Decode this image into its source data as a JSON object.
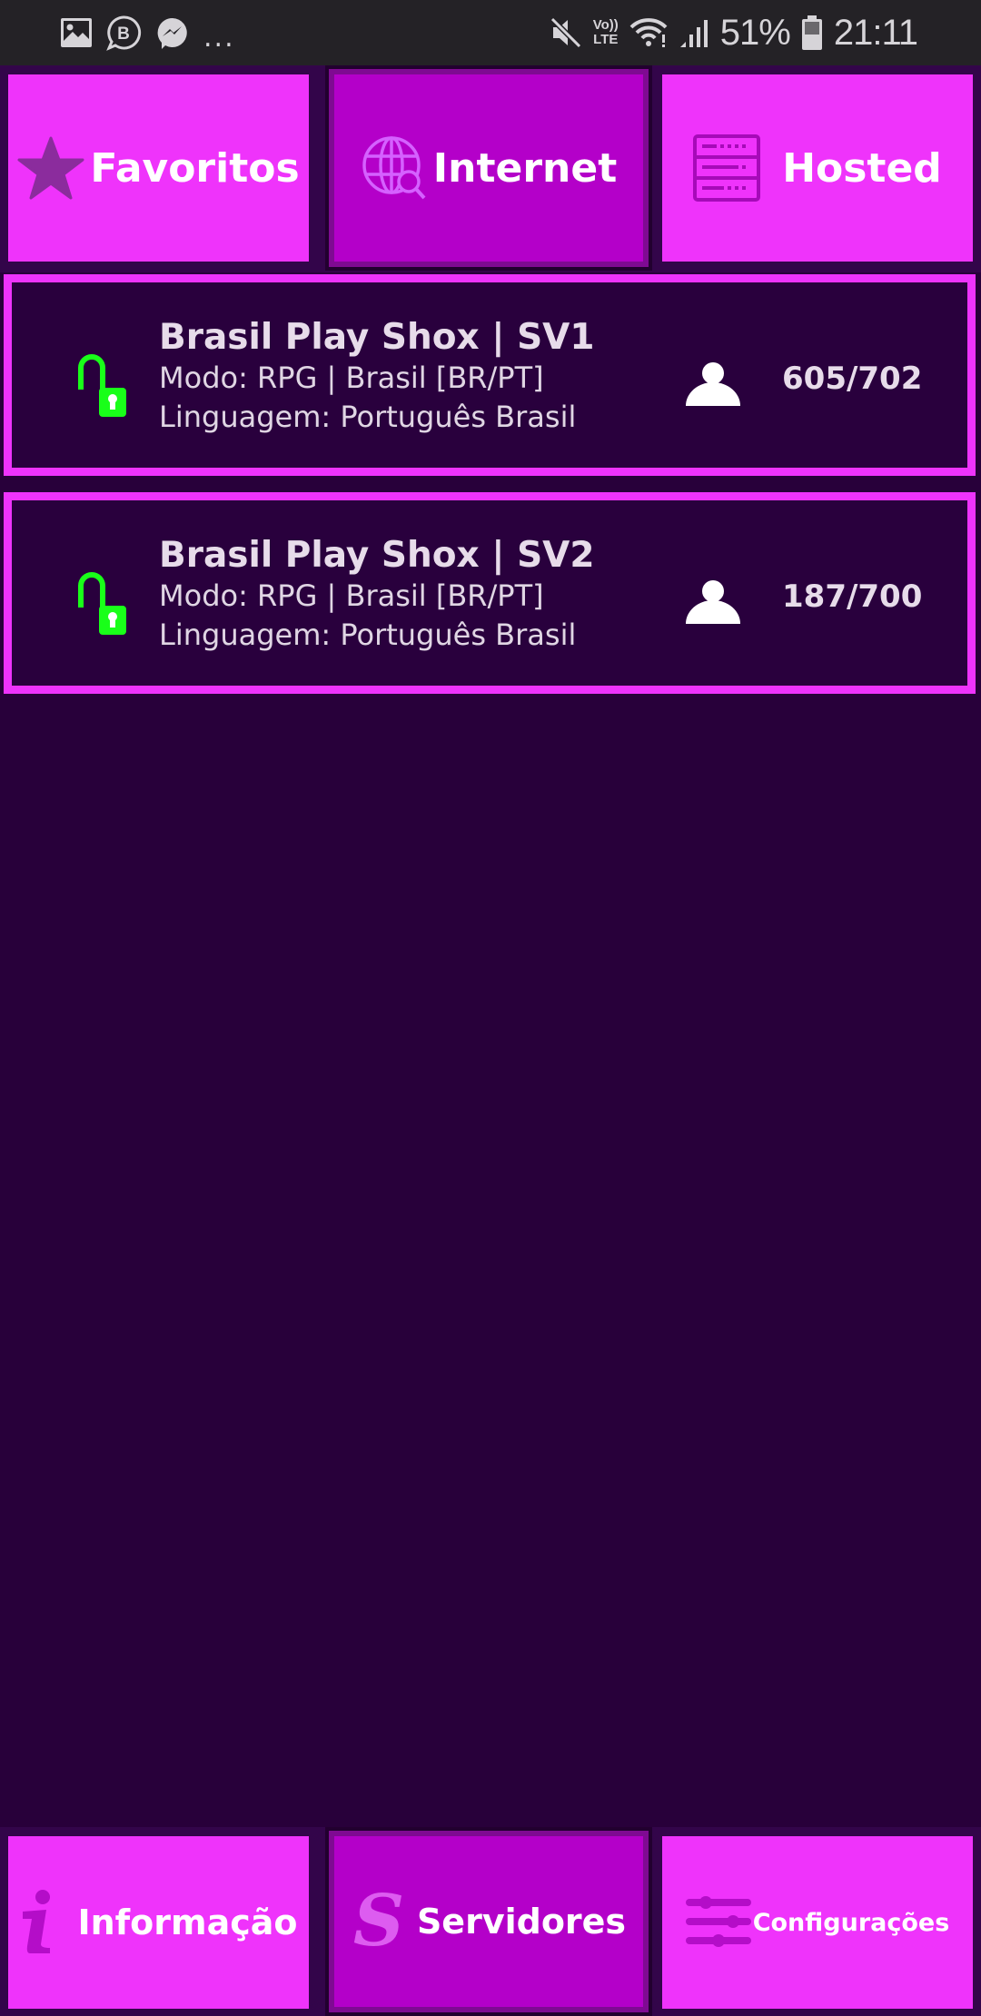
{
  "status_bar": {
    "notification_icons": [
      "gallery-icon",
      "business-chat-icon",
      "messenger-icon"
    ],
    "overflow": "...",
    "system_icons": [
      "mute-icon",
      "volte-icon",
      "wifi-icon",
      "signal-icon"
    ],
    "volte_top": "Vo))",
    "volte_bottom": "LTE",
    "battery_percent": "51%",
    "time": "21:11"
  },
  "top_tabs": [
    {
      "label": "Favoritos",
      "icon": "star-icon",
      "active": false
    },
    {
      "label": "Internet",
      "icon": "globe-search-icon",
      "active": true
    },
    {
      "label": "Hosted",
      "icon": "server-icon",
      "active": false
    }
  ],
  "servers": [
    {
      "name": "Brasil Play Shox | SV1",
      "mode": "Modo: RPG | Brasil [BR/PT]",
      "language": "Linguagem: Português Brasil",
      "players": "605/702",
      "locked": false
    },
    {
      "name": "Brasil Play Shox | SV2",
      "mode": "Modo: RPG | Brasil [BR/PT]",
      "language": "Linguagem: Português Brasil",
      "players": "187/700",
      "locked": false
    }
  ],
  "bottom_tabs": [
    {
      "label": "Informação",
      "icon": "info-icon",
      "active": false
    },
    {
      "label": "Servidores",
      "icon": "gothic-s-icon",
      "active": true
    },
    {
      "label": "Configurações",
      "icon": "sliders-icon",
      "active": false
    }
  ],
  "colors": {
    "background": "#28003a",
    "tab": "#ef33fb",
    "tab_active": "#b400c9",
    "card_border": "#ee33fc",
    "unlock_green": "#19ff19"
  }
}
